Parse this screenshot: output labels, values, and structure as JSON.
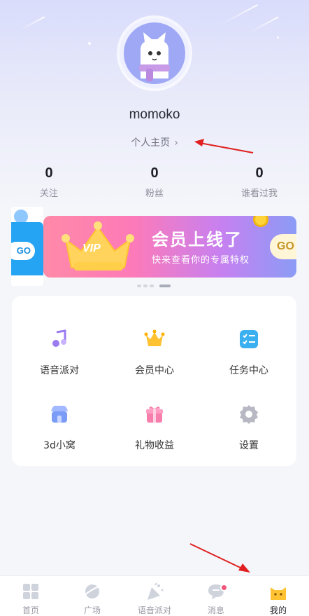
{
  "profile": {
    "username": "momoko",
    "homepage_label": "个人主页",
    "chevron_glyph": "›"
  },
  "stats": [
    {
      "value": "0",
      "label": "关注"
    },
    {
      "value": "0",
      "label": "粉丝"
    },
    {
      "value": "0",
      "label": "谁看过我"
    }
  ],
  "banner": {
    "badge": "VIP",
    "title": "会员上线了",
    "subtitle": "快来查看你的专属特权",
    "button": "GO",
    "prev_button": "GO",
    "carousel_page": 4,
    "carousel_total": 4
  },
  "menu": {
    "items": [
      {
        "label": "语音派对",
        "icon": "music-note-icon"
      },
      {
        "label": "会员中心",
        "icon": "crown-icon"
      },
      {
        "label": "任务中心",
        "icon": "checklist-icon"
      },
      {
        "label": "3d小窝",
        "icon": "store-icon"
      },
      {
        "label": "礼物收益",
        "icon": "gift-icon"
      },
      {
        "label": "设置",
        "icon": "gear-icon"
      }
    ]
  },
  "tabbar": {
    "items": [
      {
        "label": "首页",
        "icon": "grid-icon"
      },
      {
        "label": "广场",
        "icon": "planet-icon"
      },
      {
        "label": "语音派对",
        "icon": "party-popper-icon"
      },
      {
        "label": "消息",
        "icon": "chat-icon",
        "badge": true
      },
      {
        "label": "我的",
        "icon": "cat-face-icon",
        "active": true
      }
    ]
  },
  "colors": {
    "accent_yellow": "#ffc233",
    "message_badge": "#f2557a",
    "annotation_arrow": "#e02020"
  }
}
